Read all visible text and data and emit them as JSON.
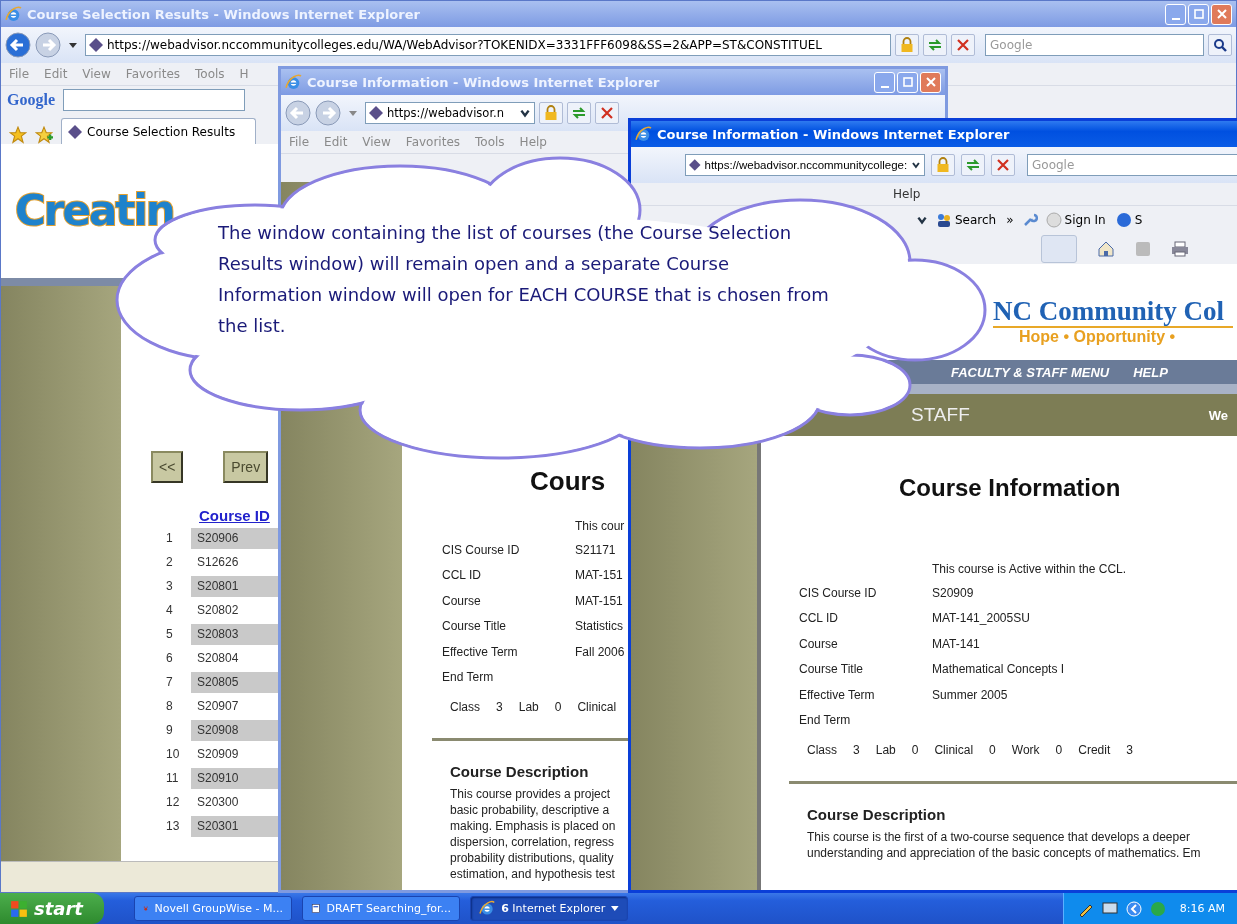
{
  "results_window": {
    "active": false,
    "title": "Course Selection Results - Windows Internet Explorer",
    "address": "https://webadvisor.nccommunitycolleges.edu/WA/WebAdvisor?TOKENIDX=3331FFF6098&SS=2&APP=ST&CONSTITUEL",
    "search_placeholder": "Google",
    "menu": [
      "File",
      "Edit",
      "View",
      "Favorites",
      "Tools",
      "H"
    ],
    "toolbar_logo": "Google",
    "tab": "Course Selection Results",
    "logo": "Creatin",
    "pager": [
      "<<",
      "Prev"
    ],
    "column_header": "Course ID",
    "rows": [
      {
        "number": "1",
        "id": "S20906"
      },
      {
        "number": "2",
        "id": "S12626"
      },
      {
        "number": "3",
        "id": "S20801"
      },
      {
        "number": "4",
        "id": "S20802"
      },
      {
        "number": "5",
        "id": "S20803"
      },
      {
        "number": "6",
        "id": "S20804"
      },
      {
        "number": "7",
        "id": "S20805"
      },
      {
        "number": "8",
        "id": "S20907"
      },
      {
        "number": "9",
        "id": "S20908"
      },
      {
        "number": "10",
        "id": "S20909"
      },
      {
        "number": "11",
        "id": "S20910"
      },
      {
        "number": "12",
        "id": "S20300"
      },
      {
        "number": "13",
        "id": "S20301"
      }
    ]
  },
  "back_info_window": {
    "active": false,
    "title": "Course Information - Windows Internet Explorer",
    "address": "https://webadvisor.n",
    "menu": [
      "File",
      "Edit",
      "View",
      "Favorites",
      "Tools",
      "Help"
    ],
    "heading": "Cours",
    "status": "This cour",
    "fields": [
      {
        "label": "CIS Course ID",
        "value": "S21171"
      },
      {
        "label": "CCL ID",
        "value": "MAT-151"
      },
      {
        "label": "Course",
        "value": "MAT-151"
      },
      {
        "label": "Course Title",
        "value": "Statistics"
      },
      {
        "label": "Effective Term",
        "value": "Fall 2006"
      },
      {
        "label": "End Term"
      }
    ],
    "hours": [
      {
        "label": "Class",
        "value": "3"
      },
      {
        "label": "Lab",
        "value": "0"
      },
      {
        "label": "Clinical"
      }
    ],
    "description_heading": "Course Description",
    "description": [
      "This course provides a project",
      "basic probability, descriptive a",
      "making. Emphasis is placed on",
      "dispersion, correlation, regress",
      "probability distributions, quality",
      "estimation, and hypothesis test"
    ]
  },
  "front_info_window": {
    "active": true,
    "title": "Course Information - Windows Internet Explorer",
    "address": "https://webadvisor.nccommunitycollege:",
    "search_placeholder": "Google",
    "menu": [
      "Help"
    ],
    "google_bar": {
      "search": "Search",
      "more": "»",
      "sign_in": "Sign In",
      "cut": "S"
    },
    "banner": {
      "title": "NC Community Col",
      "tagline": "Hope • Opportunity •",
      "nav": [
        "FACULTY & STAFF MENU",
        "HELP"
      ],
      "section": "STAFF",
      "greeting": "We"
    },
    "heading": "Course Information",
    "status": "This course is Active within the CCL.",
    "fields": [
      {
        "label": "CIS Course ID",
        "value": "S20909"
      },
      {
        "label": "CCL ID",
        "value": "MAT-141_2005SU"
      },
      {
        "label": "Course",
        "value": "MAT-141"
      },
      {
        "label": "Course Title",
        "value": "Mathematical Concepts I"
      },
      {
        "label": "Effective Term",
        "value": "Summer 2005"
      },
      {
        "label": "End Term"
      }
    ],
    "hours": [
      {
        "label": "Class",
        "value": "3"
      },
      {
        "label": "Lab",
        "value": "0"
      },
      {
        "label": "Clinical",
        "value": "0"
      },
      {
        "label": "Work",
        "value": "0"
      },
      {
        "label": "Credit",
        "value": "3"
      }
    ],
    "description_heading": "Course Description",
    "description": [
      "This course is the first of a two-course sequence that develops a deeper",
      "understanding and appreciation of the basic concepts of mathematics. Em"
    ]
  },
  "callout": {
    "text": "The window containing the list of courses (the Course Selection Results window) will remain open and a separate Course Information window will open for EACH COURSE that is chosen from the list."
  },
  "taskbar": {
    "start": "start",
    "buttons": [
      {
        "label": "Novell GroupWise - M...",
        "selected": false
      },
      {
        "label": "DRAFT Searching_for...",
        "selected": false
      },
      {
        "label": "**6** Internet Explorer",
        "selected": true
      }
    ],
    "clock": "8:16 AM"
  }
}
